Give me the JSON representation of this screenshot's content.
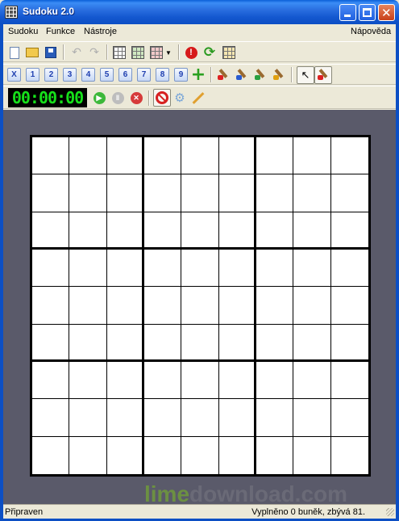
{
  "window": {
    "title": "Sudoku 2.0",
    "controls": [
      "minimize",
      "maximize",
      "close"
    ]
  },
  "menu": {
    "left": [
      "Sudoku",
      "Funkce",
      "Nástroje"
    ],
    "right": "Nápověda"
  },
  "toolbar1": {
    "icons": [
      "new-document-icon",
      "open-folder-icon",
      "save-icon",
      "undo-icon",
      "redo-icon",
      "grid-icon",
      "grid-check-icon",
      "grid-generate-icon",
      "dropdown-arrow-icon",
      "warning-icon",
      "refresh-icon",
      "grid-hint-icon"
    ]
  },
  "toolbar2": {
    "clear_label": "X",
    "numbers": [
      "1",
      "2",
      "3",
      "4",
      "5",
      "6",
      "7",
      "8",
      "9"
    ],
    "icons": [
      "plus-icon",
      "brush-red-icon",
      "brush-blue-icon",
      "brush-green-icon",
      "brush-yellow-icon",
      "cursor-icon",
      "brush-select-icon"
    ]
  },
  "timer": {
    "display": "00:00:00",
    "icons": [
      "play-icon",
      "pause-icon",
      "stop-icon",
      "no-entry-icon",
      "gear-icon",
      "pencil-icon"
    ]
  },
  "board": {
    "rows": 9,
    "cols": 9,
    "filled": 0
  },
  "watermark": {
    "part1": "lime",
    "part2": "download.com"
  },
  "status": {
    "left": "Připraven",
    "right": "Vyplněno 0 buněk, zbývá 81."
  },
  "colors": {
    "titlebar": "#0c4fc4",
    "workspace": "#5a5a6a",
    "timer_digits": "#16e01a"
  }
}
